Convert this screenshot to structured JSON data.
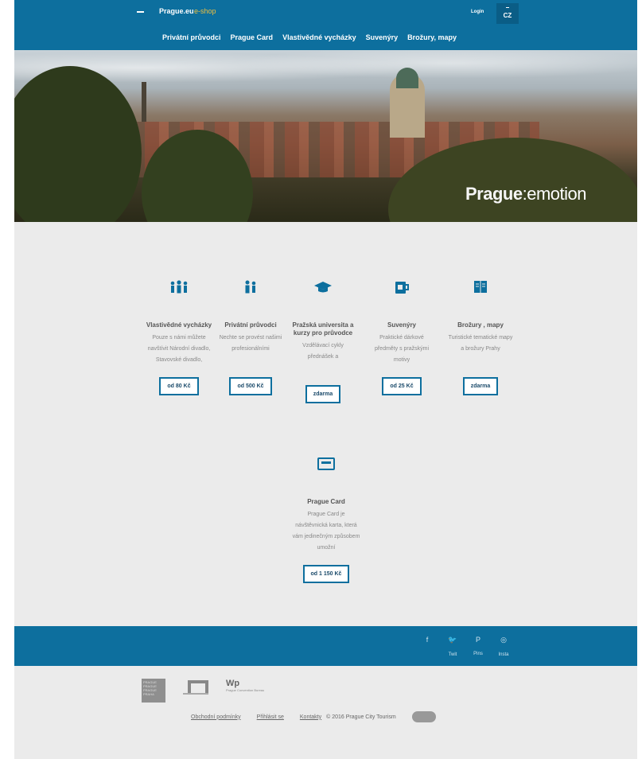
{
  "header": {
    "logo": "Prague.eu",
    "logo_sub": "e-shop",
    "login": "Login",
    "lang": "CZ"
  },
  "nav": [
    "Privátní průvodci",
    "Prague Card",
    "Vlastivědné vycházky",
    "Suvenýry",
    "Brožury, mapy"
  ],
  "hero": {
    "brand": "Prague",
    "tagline": ":emotion"
  },
  "categories": [
    {
      "icon": "group-of-three-icon",
      "title": "Vlastivědné vycházky",
      "desc": "Pouze s námi můžete navštívit Národní divadlo, Stavovské divadlo,",
      "price": "od 80 Kč"
    },
    {
      "icon": "two-persons-icon",
      "title": "Privátní průvodci",
      "desc": "Nechte se provést našimi profesionálními",
      "price": "od 500 Kč"
    },
    {
      "icon": "graduation-cap-icon",
      "title": "Pražská universita a kurzy pro průvodce",
      "desc": "Vzdělávací cykly přednášek a",
      "price": "zdarma"
    },
    {
      "icon": "mug-icon",
      "title": "Suvenýry",
      "desc": "Praktické dárkové předměty s pražskými motivy",
      "price": "od 25 Kč"
    },
    {
      "icon": "open-book-icon",
      "title": "Brožury , mapy",
      "desc": "Turistické tematické mapy a brožury Prahy",
      "price": "zdarma"
    },
    {
      "icon": "card-icon",
      "title": "Prague Card",
      "desc": "Prague Card je návštěvnická karta, která vám jedinečným způsobem umožní",
      "price": "od 1 150 Kč"
    }
  ],
  "social": [
    {
      "icon": "facebook-icon",
      "glyph": "f",
      "label": ""
    },
    {
      "icon": "twitter-icon",
      "glyph": "🐦",
      "label": "Twit"
    },
    {
      "icon": "pinterest-icon",
      "glyph": "P",
      "label": "Pins"
    },
    {
      "icon": "instagram-icon",
      "glyph": "◎",
      "label": "Insta"
    }
  ],
  "footer": {
    "logo_box": "PRAGUE PRAGUE PRAGUE PRAHA",
    "logo_wp": "Wp",
    "logo_wp_small": "Prague Convention Bureau",
    "links": [
      "Obchodní podmínky",
      "Přihlásit se",
      "Kontakty"
    ],
    "copyright": "© 2016 Prague City Tourism"
  },
  "colors": {
    "primary": "#0d6f9e",
    "background": "#ebebeb"
  }
}
